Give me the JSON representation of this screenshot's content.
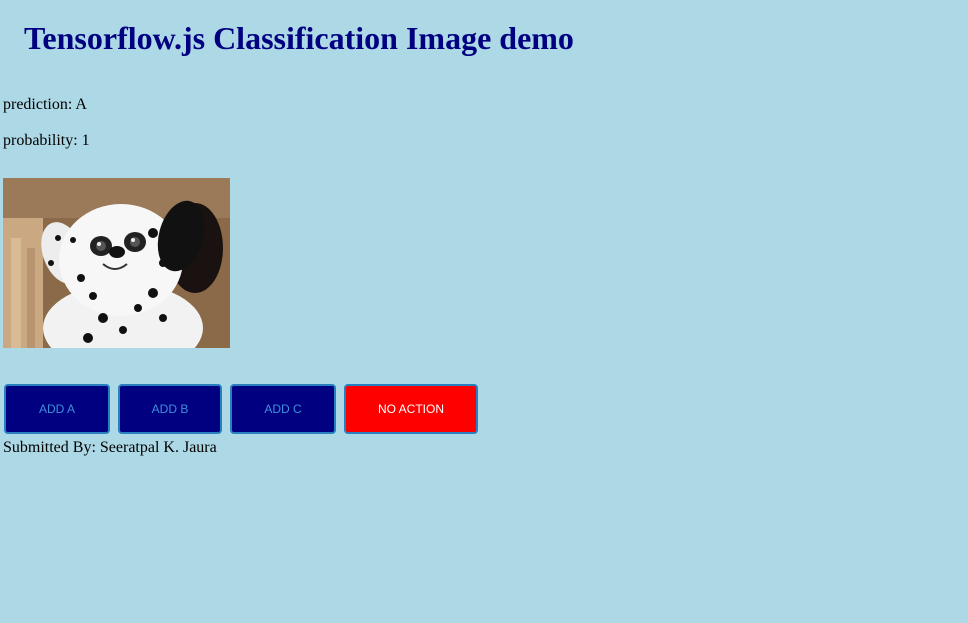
{
  "page": {
    "title": "Tensorflow.js Classification Image demo"
  },
  "prediction": {
    "label": "prediction: A"
  },
  "probability": {
    "label": "probability: 1"
  },
  "webcam": {
    "description_icon": "dalmatian-plush-toy-image"
  },
  "buttons": {
    "add_a": "ADD A",
    "add_b": "ADD B",
    "add_c": "ADD C",
    "no_action": "NO ACTION"
  },
  "footer": {
    "text": "Submitted By: Seeratpal K. Jaura"
  },
  "colors": {
    "background": "#add8e6",
    "title": "#000080",
    "button_blue": "#000080",
    "button_blue_text": "#3d8fd9",
    "button_red": "#ff0000",
    "button_red_text": "#ffffff"
  }
}
